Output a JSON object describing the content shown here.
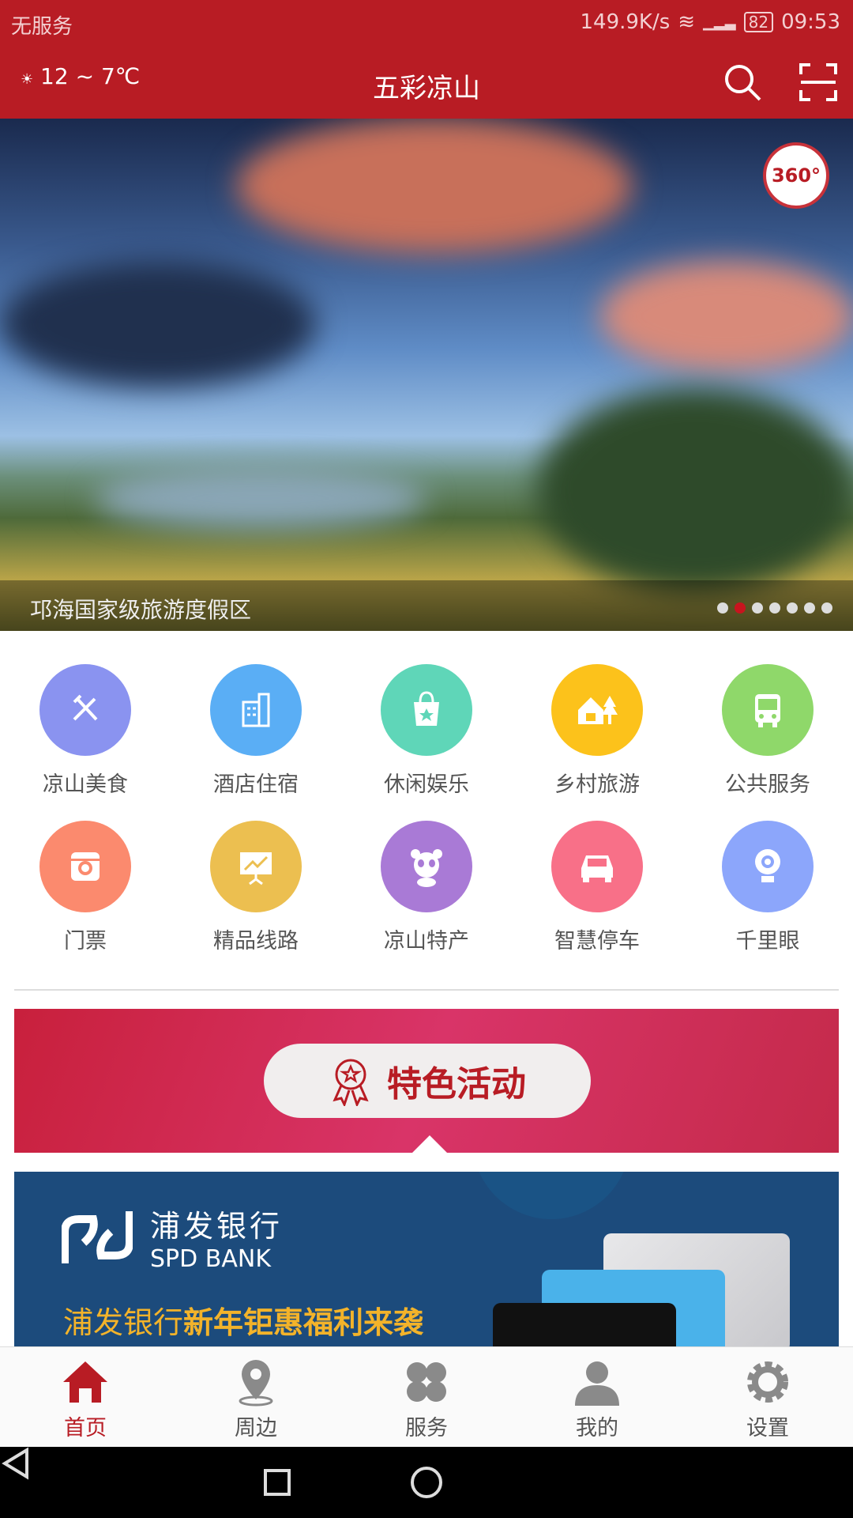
{
  "status": {
    "carrier": "无服务",
    "speed": "149.9K/s",
    "battery": "82",
    "time": "09:53"
  },
  "header": {
    "weather": "12 ~ 7℃",
    "title": "五彩凉山",
    "icons": [
      "search-icon",
      "scan-icon"
    ]
  },
  "banner": {
    "caption": "邛海国家级旅游度假区",
    "badge": "360°",
    "slides": 7,
    "active_slide": 2
  },
  "grid": [
    {
      "label": "凉山美食",
      "icon": "food-icon",
      "color": "#8a93f0"
    },
    {
      "label": "酒店住宿",
      "icon": "hotel-icon",
      "color": "#5aaef5"
    },
    {
      "label": "休闲娱乐",
      "icon": "shopping-bag-icon",
      "color": "#5fd6b8"
    },
    {
      "label": "乡村旅游",
      "icon": "village-icon",
      "color": "#fcc21b"
    },
    {
      "label": "公共服务",
      "icon": "bus-icon",
      "color": "#8fd86a"
    },
    {
      "label": "门票",
      "icon": "ticket-camera-icon",
      "color": "#fb8a6e"
    },
    {
      "label": "精品线路",
      "icon": "route-chart-icon",
      "color": "#ecbf50"
    },
    {
      "label": "凉山特产",
      "icon": "panda-icon",
      "color": "#a97ad6"
    },
    {
      "label": "智慧停车",
      "icon": "car-icon",
      "color": "#f87088"
    },
    {
      "label": "千里眼",
      "icon": "webcam-icon",
      "color": "#8ca6fb"
    }
  ],
  "activity": {
    "label": "特色活动"
  },
  "ad": {
    "bank_cn": "浦发银行",
    "bank_en": "SPD BANK",
    "promo_a": "浦发银行",
    "promo_b": "新年钜惠福利来袭"
  },
  "nav": [
    {
      "label": "首页",
      "icon": "home-icon",
      "active": true
    },
    {
      "label": "周边",
      "icon": "location-icon"
    },
    {
      "label": "服务",
      "icon": "services-icon"
    },
    {
      "label": "我的",
      "icon": "user-icon"
    },
    {
      "label": "设置",
      "icon": "gear-icon"
    }
  ],
  "colors": {
    "brand": "#b81c24"
  }
}
